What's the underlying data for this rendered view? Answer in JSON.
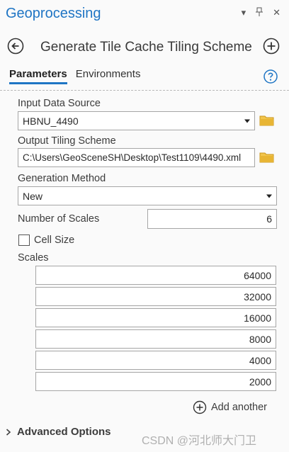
{
  "pane": {
    "title": "Geoprocessing",
    "controls": [
      "▾",
      "⊓",
      "✕"
    ]
  },
  "tool": {
    "title": "Generate Tile Cache Tiling Scheme"
  },
  "tabs": [
    {
      "label": "Parameters",
      "active": true
    },
    {
      "label": "Environments",
      "active": false
    }
  ],
  "params": {
    "input_data_source": {
      "label": "Input Data Source",
      "value": "HBNU_4490"
    },
    "output_tiling_scheme": {
      "label": "Output Tiling Scheme",
      "value": "C:\\Users\\GeoSceneSH\\Desktop\\Test1109\\4490.xml"
    },
    "generation_method": {
      "label": "Generation Method",
      "value": "New"
    },
    "number_of_scales": {
      "label": "Number of Scales",
      "value": "6"
    },
    "cell_size": {
      "label": "Cell Size",
      "checked": false
    },
    "scales": {
      "label": "Scales",
      "values": [
        "64000",
        "32000",
        "16000",
        "8000",
        "4000",
        "2000"
      ]
    }
  },
  "add_another_label": "Add another",
  "advanced_options_label": "Advanced Options",
  "watermark": "CSDN @河北师大门卫",
  "colors": {
    "accent": "#1f75c4",
    "folder": "#e8b534"
  }
}
